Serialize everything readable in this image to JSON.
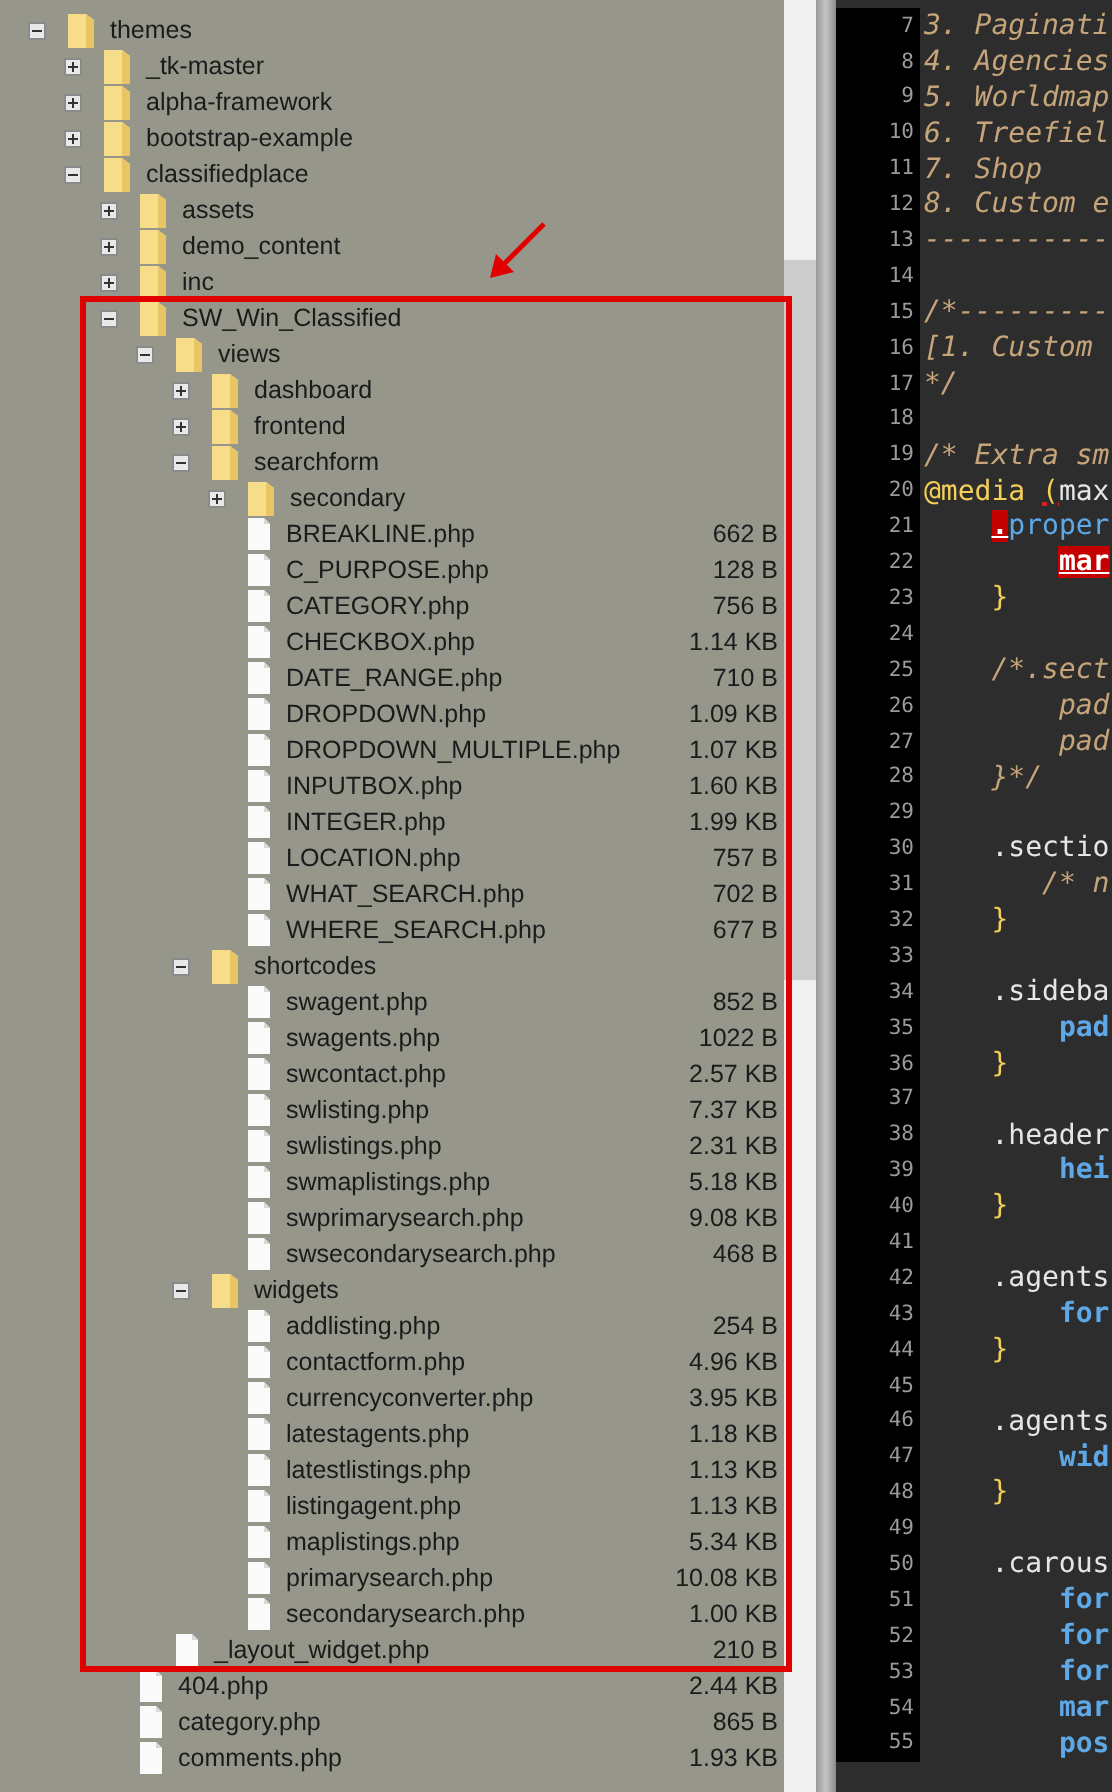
{
  "tree": [
    {
      "kind": "folder",
      "name": "themes",
      "expanded": true,
      "children": [
        {
          "kind": "folder",
          "name": "_tk-master",
          "expanded": false
        },
        {
          "kind": "folder",
          "name": "alpha-framework",
          "expanded": false
        },
        {
          "kind": "folder",
          "name": "bootstrap-example",
          "expanded": false
        },
        {
          "kind": "folder",
          "name": "classifiedplace",
          "expanded": true,
          "children": [
            {
              "kind": "folder",
              "name": "assets",
              "expanded": false
            },
            {
              "kind": "folder",
              "name": "demo_content",
              "expanded": false
            },
            {
              "kind": "folder",
              "name": "inc",
              "expanded": false
            },
            {
              "kind": "folder",
              "name": "SW_Win_Classified",
              "expanded": true,
              "highlighted": true,
              "children": [
                {
                  "kind": "folder",
                  "name": "views",
                  "expanded": true,
                  "children": [
                    {
                      "kind": "folder",
                      "name": "dashboard",
                      "expanded": false
                    },
                    {
                      "kind": "folder",
                      "name": "frontend",
                      "expanded": false
                    },
                    {
                      "kind": "folder",
                      "name": "searchform",
                      "expanded": true,
                      "children": [
                        {
                          "kind": "folder",
                          "name": "secondary",
                          "expanded": false
                        },
                        {
                          "kind": "file",
                          "name": "BREAKLINE.php",
                          "size": "662 B"
                        },
                        {
                          "kind": "file",
                          "name": "C_PURPOSE.php",
                          "size": "128 B"
                        },
                        {
                          "kind": "file",
                          "name": "CATEGORY.php",
                          "size": "756 B"
                        },
                        {
                          "kind": "file",
                          "name": "CHECKBOX.php",
                          "size": "1.14 KB"
                        },
                        {
                          "kind": "file",
                          "name": "DATE_RANGE.php",
                          "size": "710 B"
                        },
                        {
                          "kind": "file",
                          "name": "DROPDOWN.php",
                          "size": "1.09 KB"
                        },
                        {
                          "kind": "file",
                          "name": "DROPDOWN_MULTIPLE.php",
                          "size": "1.07 KB"
                        },
                        {
                          "kind": "file",
                          "name": "INPUTBOX.php",
                          "size": "1.60 KB"
                        },
                        {
                          "kind": "file",
                          "name": "INTEGER.php",
                          "size": "1.99 KB"
                        },
                        {
                          "kind": "file",
                          "name": "LOCATION.php",
                          "size": "757 B"
                        },
                        {
                          "kind": "file",
                          "name": "WHAT_SEARCH.php",
                          "size": "702 B"
                        },
                        {
                          "kind": "file",
                          "name": "WHERE_SEARCH.php",
                          "size": "677 B"
                        }
                      ]
                    },
                    {
                      "kind": "folder",
                      "name": "shortcodes",
                      "expanded": true,
                      "children": [
                        {
                          "kind": "file",
                          "name": "swagent.php",
                          "size": "852 B"
                        },
                        {
                          "kind": "file",
                          "name": "swagents.php",
                          "size": "1022 B"
                        },
                        {
                          "kind": "file",
                          "name": "swcontact.php",
                          "size": "2.57 KB"
                        },
                        {
                          "kind": "file",
                          "name": "swlisting.php",
                          "size": "7.37 KB"
                        },
                        {
                          "kind": "file",
                          "name": "swlistings.php",
                          "size": "2.31 KB"
                        },
                        {
                          "kind": "file",
                          "name": "swmaplistings.php",
                          "size": "5.18 KB"
                        },
                        {
                          "kind": "file",
                          "name": "swprimarysearch.php",
                          "size": "9.08 KB"
                        },
                        {
                          "kind": "file",
                          "name": "swsecondarysearch.php",
                          "size": "468 B"
                        }
                      ]
                    },
                    {
                      "kind": "folder",
                      "name": "widgets",
                      "expanded": true,
                      "children": [
                        {
                          "kind": "file",
                          "name": "addlisting.php",
                          "size": "254 B"
                        },
                        {
                          "kind": "file",
                          "name": "contactform.php",
                          "size": "4.96 KB"
                        },
                        {
                          "kind": "file",
                          "name": "currencyconverter.php",
                          "size": "3.95 KB"
                        },
                        {
                          "kind": "file",
                          "name": "latestagents.php",
                          "size": "1.18 KB"
                        },
                        {
                          "kind": "file",
                          "name": "latestlistings.php",
                          "size": "1.13 KB"
                        },
                        {
                          "kind": "file",
                          "name": "listingagent.php",
                          "size": "1.13 KB"
                        },
                        {
                          "kind": "file",
                          "name": "maplistings.php",
                          "size": "5.34 KB"
                        },
                        {
                          "kind": "file",
                          "name": "primarysearch.php",
                          "size": "10.08 KB"
                        },
                        {
                          "kind": "file",
                          "name": "secondarysearch.php",
                          "size": "1.00 KB"
                        }
                      ]
                    }
                  ]
                },
                {
                  "kind": "file",
                  "name": "_layout_widget.php",
                  "size": "210 B"
                }
              ]
            },
            {
              "kind": "file",
              "name": "404.php",
              "size": "2.44 KB"
            },
            {
              "kind": "file",
              "name": "category.php",
              "size": "865 B"
            },
            {
              "kind": "file",
              "name": "comments.php",
              "size": "1.93 KB"
            }
          ]
        }
      ]
    }
  ],
  "code": [
    {
      "number": "7",
      "segments": [
        {
          "kind": "comment",
          "text": "3. Paginati"
        }
      ]
    },
    {
      "number": "8",
      "segments": [
        {
          "kind": "comment",
          "text": "4. Agencies"
        }
      ]
    },
    {
      "number": "9",
      "segments": [
        {
          "kind": "comment",
          "text": "5. Worldmap"
        }
      ]
    },
    {
      "number": "10",
      "segments": [
        {
          "kind": "comment",
          "text": "6. Treefiel"
        }
      ]
    },
    {
      "number": "11",
      "segments": [
        {
          "kind": "comment",
          "text": "7. Shop"
        }
      ]
    },
    {
      "number": "12",
      "segments": [
        {
          "kind": "comment",
          "text": "8. Custom e"
        }
      ]
    },
    {
      "number": "13",
      "segments": [
        {
          "kind": "comment",
          "text": "-----------"
        }
      ]
    },
    {
      "number": "14"
    },
    {
      "number": "15",
      "segments": [
        {
          "kind": "comment",
          "text": "/*---------"
        }
      ]
    },
    {
      "number": "16",
      "segments": [
        {
          "kind": "comment",
          "text": "[1. Custom"
        }
      ]
    },
    {
      "number": "17",
      "segments": [
        {
          "kind": "comment",
          "text": "*/"
        }
      ]
    },
    {
      "number": "18"
    },
    {
      "number": "19",
      "segments": [
        {
          "kind": "comment",
          "text": "/* Extra sm"
        }
      ]
    },
    {
      "number": "20",
      "segments": [
        {
          "kind": "keyword",
          "text": "@media "
        },
        {
          "kind": "match",
          "text": "("
        },
        {
          "kind": "plain",
          "text": "max"
        }
      ]
    },
    {
      "number": "21",
      "segments": [
        {
          "kind": "error",
          "text": "    ."
        },
        {
          "kind": "selector",
          "text": "proper"
        }
      ]
    },
    {
      "number": "22",
      "segments": [
        {
          "kind": "error",
          "text": "        mar"
        }
      ]
    },
    {
      "number": "23",
      "segments": [
        {
          "kind": "brace",
          "text": "    }"
        }
      ]
    },
    {
      "number": "24"
    },
    {
      "number": "25",
      "segments": [
        {
          "kind": "comment",
          "text": "    /*.sect"
        }
      ]
    },
    {
      "number": "26",
      "segments": [
        {
          "kind": "comment",
          "text": "        pad"
        }
      ]
    },
    {
      "number": "27",
      "segments": [
        {
          "kind": "comment",
          "text": "        pad"
        }
      ]
    },
    {
      "number": "28",
      "segments": [
        {
          "kind": "comment",
          "text": "    }*/"
        }
      ]
    },
    {
      "number": "29"
    },
    {
      "number": "30",
      "segments": [
        {
          "kind": "plain",
          "text": "    .sectio"
        }
      ]
    },
    {
      "number": "31",
      "segments": [
        {
          "kind": "comment",
          "text": "       /* n"
        }
      ]
    },
    {
      "number": "32",
      "segments": [
        {
          "kind": "brace",
          "text": "    }"
        }
      ]
    },
    {
      "number": "33"
    },
    {
      "number": "34",
      "segments": [
        {
          "kind": "plain",
          "text": "    .sideba"
        }
      ]
    },
    {
      "number": "35",
      "segments": [
        {
          "kind": "property",
          "text": "        pad"
        }
      ]
    },
    {
      "number": "36",
      "segments": [
        {
          "kind": "brace",
          "text": "    }"
        }
      ]
    },
    {
      "number": "37"
    },
    {
      "number": "38",
      "segments": [
        {
          "kind": "plain",
          "text": "    .header"
        }
      ]
    },
    {
      "number": "39",
      "segments": [
        {
          "kind": "property",
          "text": "        hei"
        }
      ]
    },
    {
      "number": "40",
      "segments": [
        {
          "kind": "brace",
          "text": "    }"
        }
      ]
    },
    {
      "number": "41"
    },
    {
      "number": "42",
      "segments": [
        {
          "kind": "plain",
          "text": "    .agents"
        }
      ]
    },
    {
      "number": "43",
      "segments": [
        {
          "kind": "property",
          "text": "        for"
        }
      ]
    },
    {
      "number": "44",
      "segments": [
        {
          "kind": "brace",
          "text": "    }"
        }
      ]
    },
    {
      "number": "45"
    },
    {
      "number": "46",
      "segments": [
        {
          "kind": "plain",
          "text": "    .agents"
        }
      ]
    },
    {
      "number": "47",
      "segments": [
        {
          "kind": "property",
          "text": "        wid"
        }
      ]
    },
    {
      "number": "48",
      "segments": [
        {
          "kind": "brace",
          "text": "    }"
        }
      ]
    },
    {
      "number": "49"
    },
    {
      "number": "50",
      "segments": [
        {
          "kind": "plain",
          "text": "    .carous"
        }
      ]
    },
    {
      "number": "51",
      "segments": [
        {
          "kind": "property",
          "text": "        for"
        }
      ]
    },
    {
      "number": "52",
      "segments": [
        {
          "kind": "property",
          "text": "        for"
        }
      ]
    },
    {
      "number": "53",
      "segments": [
        {
          "kind": "property",
          "text": "        for"
        }
      ]
    },
    {
      "number": "54",
      "segments": [
        {
          "kind": "property",
          "text": "        mar"
        }
      ]
    },
    {
      "number": "55",
      "segments": [
        {
          "kind": "property",
          "text": "        pos"
        }
      ]
    }
  ]
}
